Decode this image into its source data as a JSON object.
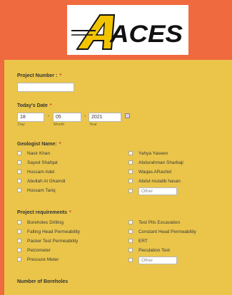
{
  "logo": {
    "text": "ACES"
  },
  "project_number": {
    "label": "Project Number :",
    "required_mark": "*",
    "value": ""
  },
  "todays_date": {
    "label": "Today's Date",
    "required_mark": "*",
    "day": "18",
    "month": "05",
    "year": "2021",
    "day_label": "Day",
    "month_label": "Month",
    "year_label": "Year",
    "separator": "-"
  },
  "geologist": {
    "label": "Geologist Name:",
    "required_mark": "*",
    "left": [
      "Nasir Khan",
      "Sayed Shafqat",
      "Hussam Adel",
      "Abullah Al Ghamdi",
      "Hussam Tariq"
    ],
    "right": [
      "Yahya Yaseen",
      "Abdurahman Sharbaji",
      "Waqas ARashid",
      "Abdul mutalib hasan"
    ],
    "other_placeholder": "Other"
  },
  "requirements": {
    "label": "Project requirements",
    "required_mark": "*",
    "left": [
      "Boreholes Drilling",
      "Falling Head Permeability",
      "Packer Test Permeability",
      "Peizometer",
      "Pressure Meter"
    ],
    "right": [
      "Test Pits Excavation",
      "Constant Head Permeability",
      "ERT",
      "Peculation Test"
    ],
    "other_placeholder": "Other"
  },
  "boreholes": {
    "label": "Number of Boreholes"
  },
  "colors": {
    "background": "#ef6a3e",
    "form": "#eac54a",
    "logo_yellow": "#f2c400"
  }
}
